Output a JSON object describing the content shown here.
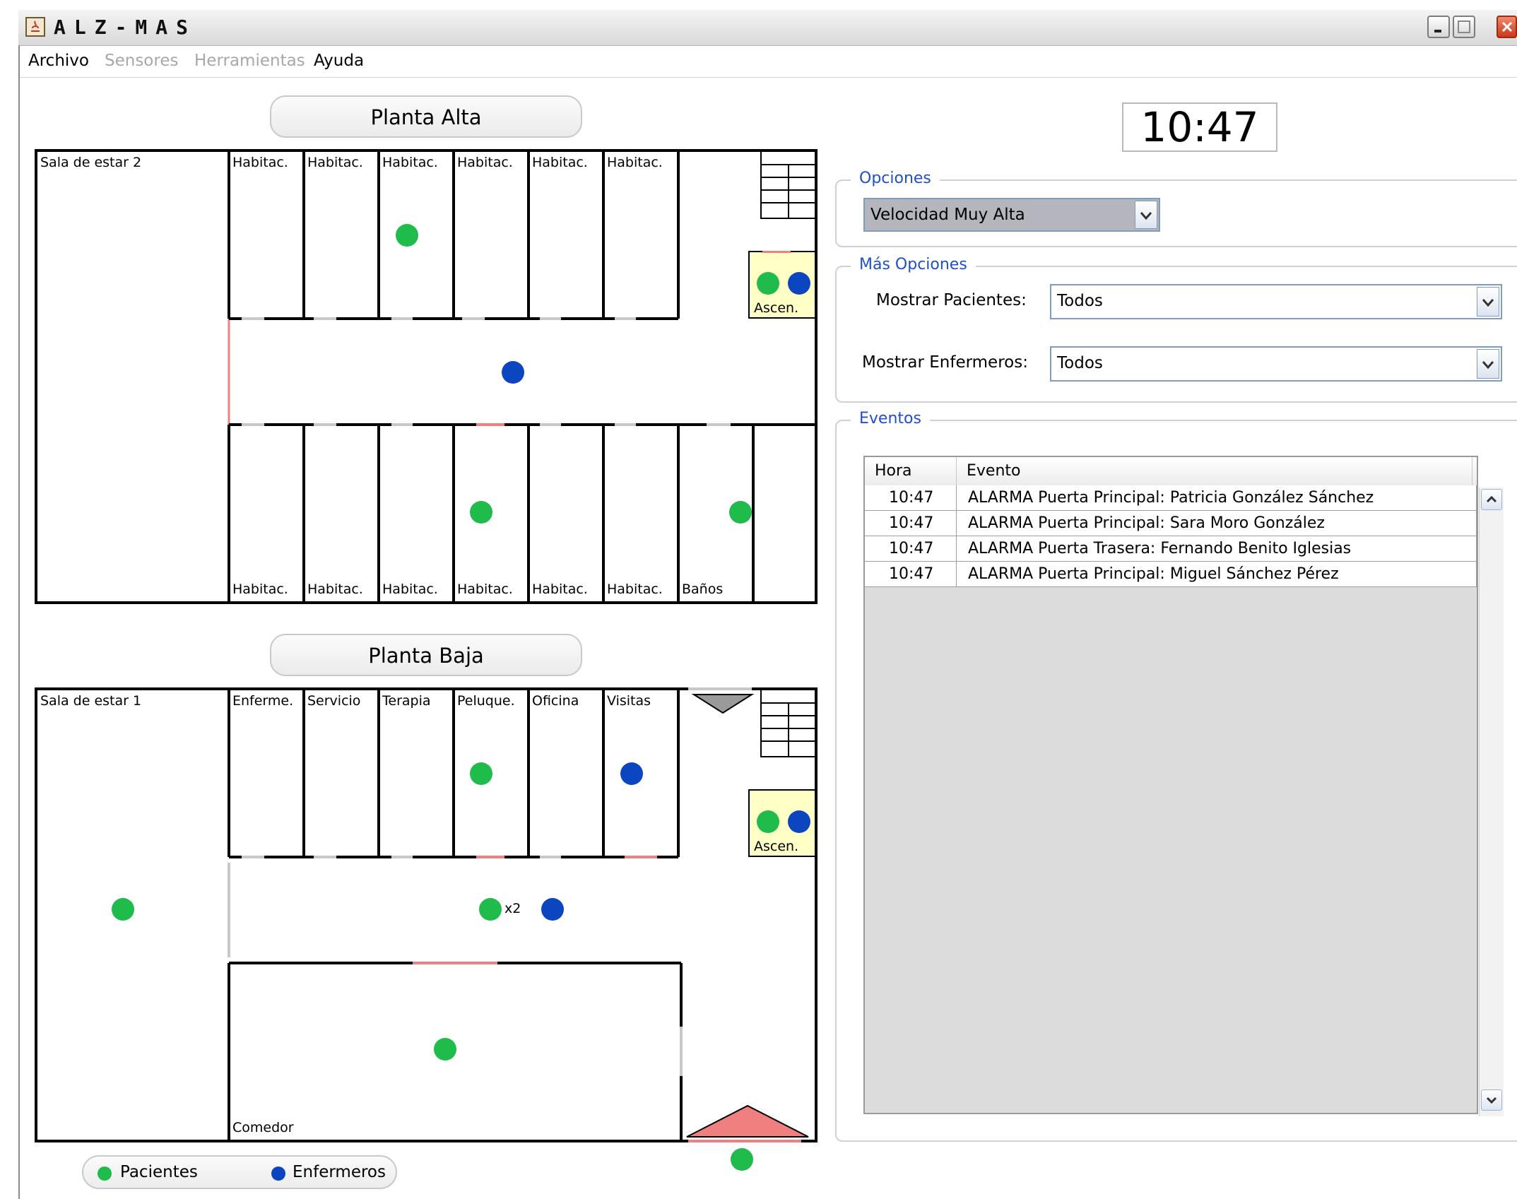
{
  "window": {
    "title": "ALZ-MAS"
  },
  "menu": [
    {
      "label": "Archivo",
      "enabled": true
    },
    {
      "label": "Sensores",
      "enabled": false
    },
    {
      "label": "Herramientas",
      "enabled": false
    },
    {
      "label": "Ayuda",
      "enabled": true
    }
  ],
  "upper_floor": {
    "button": "Planta Alta",
    "rooms_top": [
      "Sala de estar 2",
      "Habitac.",
      "Habitac.",
      "Habitac.",
      "Habitac.",
      "Habitac.",
      "Habitac."
    ],
    "rooms_bottom": [
      "Habitac.",
      "Habitac.",
      "Habitac.",
      "Habitac.",
      "Habitac.",
      "Habitac.",
      "Baños"
    ],
    "elevator": "Ascen."
  },
  "lower_floor": {
    "button": "Planta Baja",
    "rooms_top": [
      "Sala de estar 1",
      "Enferme.",
      "Servicio",
      "Terapia",
      "Peluque.",
      "Oficina",
      "Visitas"
    ],
    "dining": "Comedor",
    "elevator": "Ascen.",
    "hall_count": "x2"
  },
  "clock": "10:47",
  "options": {
    "title": "Opciones",
    "speed": "Velocidad Muy Alta"
  },
  "more_options": {
    "title": "Más Opciones",
    "patients_label": "Mostrar Pacientes:",
    "patients_value": "Todos",
    "nurses_label": "Mostrar Enfermeros:",
    "nurses_value": "Todos"
  },
  "events": {
    "title": "Eventos",
    "columns": [
      "Hora",
      "Evento"
    ],
    "rows": [
      {
        "time": "10:47",
        "event": "ALARMA Puerta Principal: Patricia González Sánchez"
      },
      {
        "time": "10:47",
        "event": "ALARMA Puerta Principal: Sara Moro González"
      },
      {
        "time": "10:47",
        "event": "ALARMA Puerta Trasera: Fernando Benito Iglesias"
      },
      {
        "time": "10:47",
        "event": "ALARMA Puerta Principal: Miguel Sánchez Pérez"
      }
    ]
  },
  "legend": {
    "patients": "Pacientes",
    "nurses": "Enfermeros"
  },
  "colors": {
    "patient": "#1fbc4b",
    "nurse": "#0b45c0",
    "alarm": "#f08080",
    "elevator": "#ffffc6",
    "accent": "#1f4fcf"
  }
}
